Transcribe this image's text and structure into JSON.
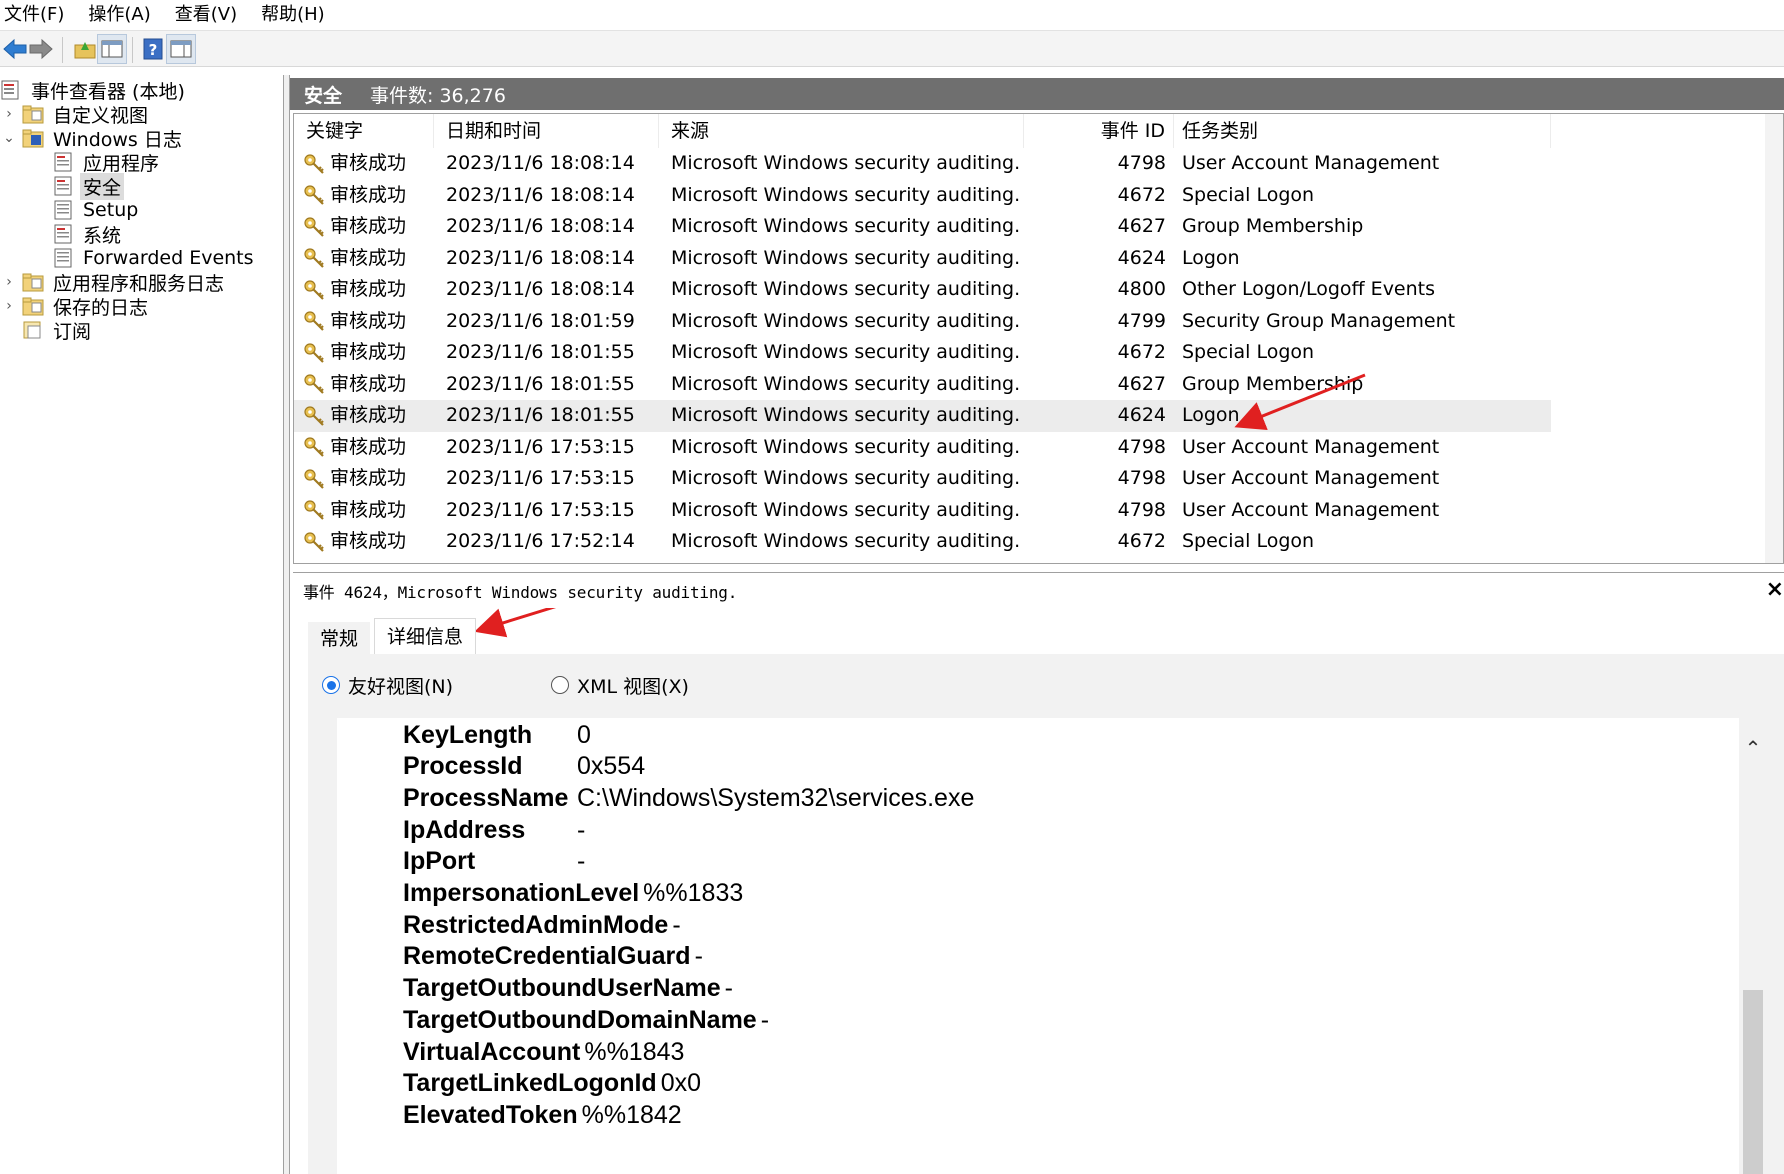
{
  "menu": [
    "文件(F)",
    "操作(A)",
    "查看(V)",
    "帮助(H)"
  ],
  "toolbar_icons": [
    "back-arrow-icon",
    "forward-arrow-icon",
    "folder-up-icon",
    "console-tree-icon",
    "help-icon",
    "action-pane-icon"
  ],
  "tree": {
    "root": "事件查看器 (本地)",
    "custom_views": "自定义视图",
    "windows_logs": "Windows 日志",
    "application": "应用程序",
    "security": "安全",
    "setup": "Setup",
    "system": "系统",
    "forwarded": "Forwarded Events",
    "app_services": "应用程序和服务日志",
    "saved": "保存的日志",
    "subscriptions": "订阅"
  },
  "pane": {
    "title": "安全",
    "count": "事件数: 36,276"
  },
  "columns": {
    "keyword": "关键字",
    "datetime": "日期和时间",
    "source": "来源",
    "event_id": "事件 ID",
    "task": "任务类别"
  },
  "events": [
    {
      "keyword": "审核成功",
      "datetime": "2023/11/6 18:08:14",
      "source": "Microsoft Windows security auditing.",
      "id": "4798",
      "task": "User Account Management"
    },
    {
      "keyword": "审核成功",
      "datetime": "2023/11/6 18:08:14",
      "source": "Microsoft Windows security auditing.",
      "id": "4672",
      "task": "Special Logon"
    },
    {
      "keyword": "审核成功",
      "datetime": "2023/11/6 18:08:14",
      "source": "Microsoft Windows security auditing.",
      "id": "4627",
      "task": "Group Membership"
    },
    {
      "keyword": "审核成功",
      "datetime": "2023/11/6 18:08:14",
      "source": "Microsoft Windows security auditing.",
      "id": "4624",
      "task": "Logon"
    },
    {
      "keyword": "审核成功",
      "datetime": "2023/11/6 18:08:14",
      "source": "Microsoft Windows security auditing.",
      "id": "4800",
      "task": "Other Logon/Logoff Events"
    },
    {
      "keyword": "审核成功",
      "datetime": "2023/11/6 18:01:59",
      "source": "Microsoft Windows security auditing.",
      "id": "4799",
      "task": "Security Group Management"
    },
    {
      "keyword": "审核成功",
      "datetime": "2023/11/6 18:01:55",
      "source": "Microsoft Windows security auditing.",
      "id": "4672",
      "task": "Special Logon"
    },
    {
      "keyword": "审核成功",
      "datetime": "2023/11/6 18:01:55",
      "source": "Microsoft Windows security auditing.",
      "id": "4627",
      "task": "Group Membership"
    },
    {
      "keyword": "审核成功",
      "datetime": "2023/11/6 18:01:55",
      "source": "Microsoft Windows security auditing.",
      "id": "4624",
      "task": "Logon",
      "selected": true
    },
    {
      "keyword": "审核成功",
      "datetime": "2023/11/6 17:53:15",
      "source": "Microsoft Windows security auditing.",
      "id": "4798",
      "task": "User Account Management"
    },
    {
      "keyword": "审核成功",
      "datetime": "2023/11/6 17:53:15",
      "source": "Microsoft Windows security auditing.",
      "id": "4798",
      "task": "User Account Management"
    },
    {
      "keyword": "审核成功",
      "datetime": "2023/11/6 17:53:15",
      "source": "Microsoft Windows security auditing.",
      "id": "4798",
      "task": "User Account Management"
    },
    {
      "keyword": "审核成功",
      "datetime": "2023/11/6 17:52:14",
      "source": "Microsoft Windows security auditing.",
      "id": "4672",
      "task": "Special Logon"
    }
  ],
  "details": {
    "title": "事件 4624，Microsoft Windows security auditing.",
    "tab_general": "常规",
    "tab_details": "详细信息",
    "radio_friendly": "友好视图(N)",
    "radio_xml": "XML 视图(X)",
    "fields": [
      {
        "key": "KeyLength",
        "value": "0"
      },
      {
        "key": "ProcessId",
        "value": "0x554"
      },
      {
        "key": "ProcessName",
        "value": "C:\\Windows\\System32\\services.exe"
      },
      {
        "key": "IpAddress",
        "value": "-"
      },
      {
        "key": "IpPort",
        "value": "-"
      },
      {
        "key": "ImpersonationLevel",
        "value": "%%1833"
      },
      {
        "key": "RestrictedAdminMode",
        "value": "-"
      },
      {
        "key": "RemoteCredentialGuard",
        "value": "-"
      },
      {
        "key": "TargetOutboundUserName",
        "value": "-"
      },
      {
        "key": "TargetOutboundDomainName",
        "value": "-"
      },
      {
        "key": "VirtualAccount",
        "value": "%%1843"
      },
      {
        "key": "TargetLinkedLogonId",
        "value": "0x0"
      },
      {
        "key": "ElevatedToken",
        "value": "%%1842"
      }
    ]
  },
  "colors": {
    "header_bg": "#6f6f6f",
    "selection": "#ececec",
    "annotation_arrow": "#e02020",
    "radio_accent": "#1a73e8"
  }
}
